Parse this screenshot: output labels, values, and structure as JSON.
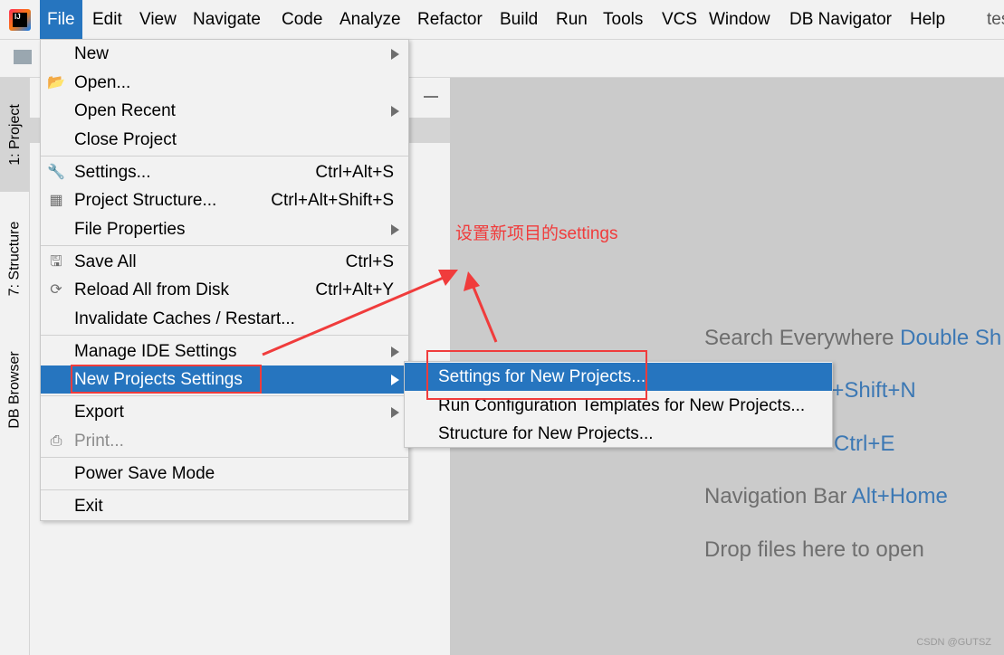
{
  "menubar": {
    "items": [
      "File",
      "Edit",
      "View",
      "Navigate",
      "Code",
      "Analyze",
      "Refactor",
      "Build",
      "Run",
      "Tools",
      "VCS",
      "Window",
      "DB Navigator",
      "Help"
    ],
    "title_partial": "tes"
  },
  "tool_windows": {
    "project": "1: Project",
    "structure": "7: Structure",
    "db_browser": "DB Browser"
  },
  "file_menu": {
    "new": "New",
    "open": "Open...",
    "open_recent": "Open Recent",
    "close_project": "Close Project",
    "settings": "Settings...",
    "settings_shortcut": "Ctrl+Alt+S",
    "project_structure": "Project Structure...",
    "project_structure_shortcut": "Ctrl+Alt+Shift+S",
    "file_properties": "File Properties",
    "save_all": "Save All",
    "save_all_shortcut": "Ctrl+S",
    "reload": "Reload All from Disk",
    "reload_shortcut": "Ctrl+Alt+Y",
    "invalidate": "Invalidate Caches / Restart...",
    "manage_ide": "Manage IDE Settings",
    "new_projects_settings": "New Projects Settings",
    "export": "Export",
    "print": "Print...",
    "power_save": "Power Save Mode",
    "exit": "Exit"
  },
  "submenu": {
    "items": [
      "Settings for New Projects...",
      "Run Configuration Templates for New Projects...",
      "Structure for New Projects..."
    ]
  },
  "welcome": {
    "search_label": "Search Everywhere",
    "search_key": "Double Sh",
    "goto_key": "rl+Shift+N",
    "recent_key": "Ctrl+E",
    "nav_label": "Navigation Bar",
    "nav_key": "Alt+Home",
    "drop": "Drop files here to open"
  },
  "annotation": {
    "text": "设置新项目的settings",
    "color": "#f03c3c"
  },
  "accent": "#2675bf",
  "watermark": "CSDN @GUTSZ"
}
